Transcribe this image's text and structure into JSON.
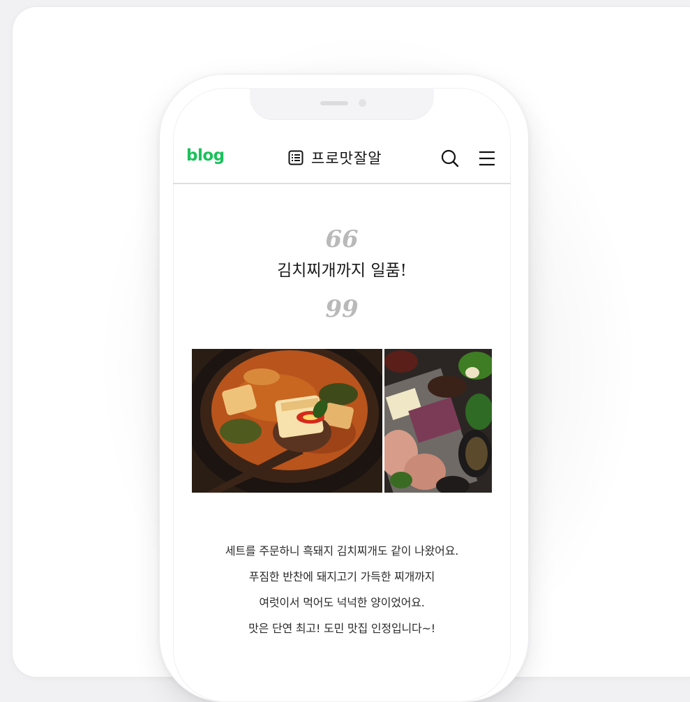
{
  "blog": {
    "logo": "blog",
    "title": "프로맛잘알"
  },
  "post": {
    "quote_open": "66",
    "quote_close": "99",
    "quote": "김치찌개까지 일품!",
    "caption": [
      "세트를 주문하니 흑돼지 김치찌개도 같이 나왔어요.",
      "푸짐한 반찬에 돼지고기 가득한 찌개까지",
      "여럿이서 먹어도 넉넉한 양이었어요.",
      "맛은 단연 최고! 도민 맛집 인정입니다~!"
    ]
  },
  "icons": [
    "list-icon",
    "search-icon",
    "hamburger-menu-icon"
  ],
  "colors": {
    "brand": "#19c25b",
    "quote_mark": "#b9b9b9",
    "text": "#2b2b2b",
    "divider": "#dedee2"
  }
}
